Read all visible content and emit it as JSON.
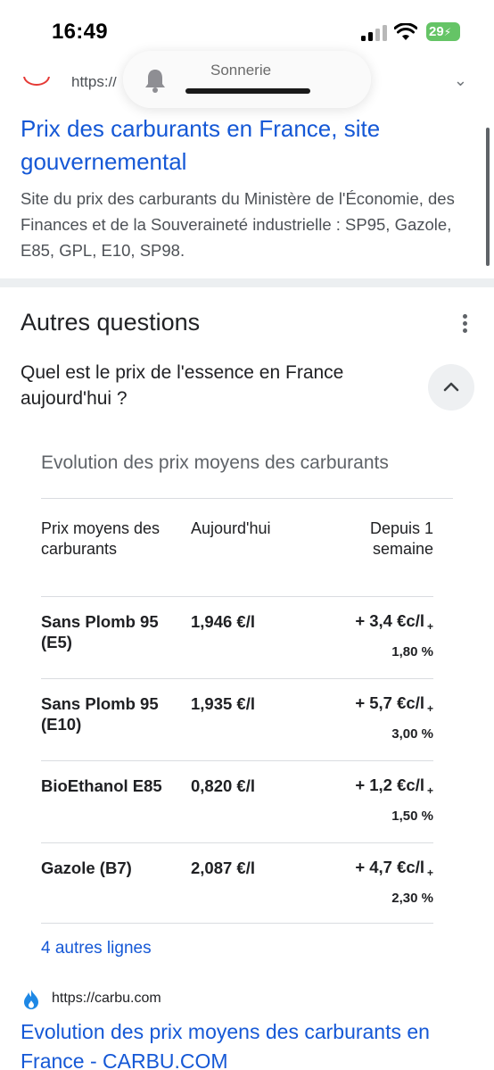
{
  "status_bar": {
    "time": "16:49",
    "battery": "29"
  },
  "notification": {
    "label": "Sonnerie",
    "icon": "bell-icon"
  },
  "result1": {
    "url": "https://",
    "title": "Prix des carburants en France, site gouvernemental",
    "snippet": "Site du prix des carburants du Ministère de l'Économie, des Finances et de la Souveraineté industrielle : SP95, Gazole, E85, GPL, E10, SP98."
  },
  "people_also_ask": {
    "title": "Autres questions",
    "question": "Quel est le prix de l'essence en France aujourd'hui ?",
    "table": {
      "title": "Evolution des prix moyens des carburants",
      "headers": [
        "Prix moyens des carburants",
        "Aujourd'hui",
        "Depuis 1 semaine"
      ],
      "rows": [
        {
          "name": "Sans Plomb 95 (E5)",
          "price": "1,946 €/l",
          "change": "+ 3,4 €c/l",
          "pct": "1,80 %"
        },
        {
          "name": "Sans Plomb 95 (E10)",
          "price": "1,935 €/l",
          "change": "+ 5,7 €c/l",
          "pct": "3,00 %"
        },
        {
          "name": "BioEthanol E85",
          "price": "0,820 €/l",
          "change": "+ 1,2 €c/l",
          "pct": "1,50 %"
        },
        {
          "name": "Gazole (B7)",
          "price": "2,087 €/l",
          "change": "+ 4,7 €c/l",
          "pct": "2,30 %"
        }
      ],
      "plus_sign": "+"
    },
    "more_lines": "4 autres lignes"
  },
  "result2": {
    "url": "https://carbu.com",
    "title": "Evolution des prix moyens des carburants en France - CARBU.COM"
  },
  "colors": {
    "link": "#1558d6",
    "text": "#202124",
    "muted": "#4d5156",
    "battery": "#65c466"
  }
}
